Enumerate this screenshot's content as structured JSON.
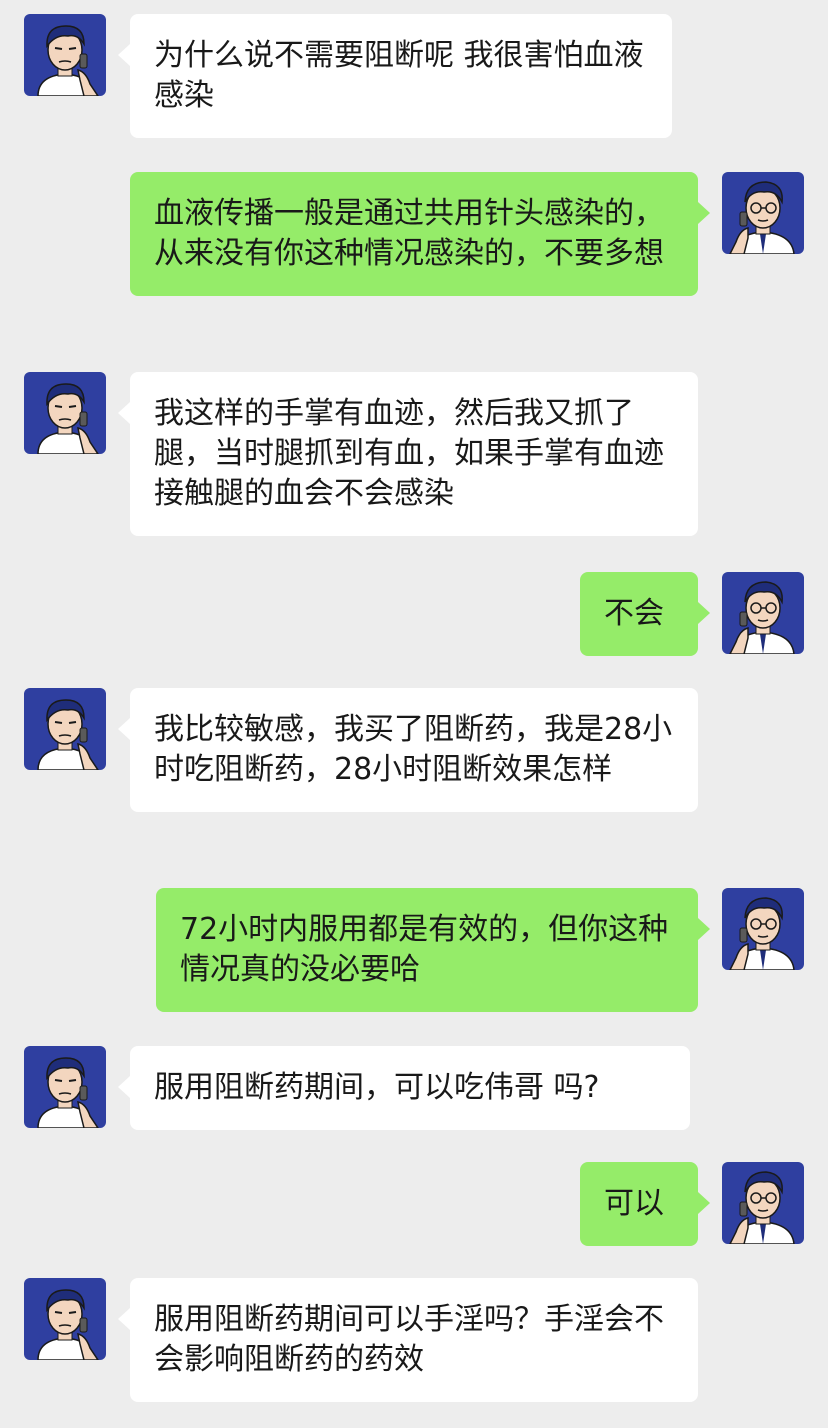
{
  "colors": {
    "background": "#ededed",
    "incoming_bubble": "#ffffff",
    "outgoing_bubble": "#95ec69",
    "avatar_bg": "#2f3fa0"
  },
  "avatars": {
    "patient": "patient-avatar-icon",
    "doctor": "doctor-avatar-icon"
  },
  "messages": [
    {
      "sender": "patient",
      "text": "为什么说不需要阻断呢 我很害怕血液感染"
    },
    {
      "sender": "doctor",
      "text": "血液传播一般是通过共用针头感染的，从来没有你这种情况感染的，不要多想"
    },
    {
      "sender": "patient",
      "text": " 我这样的手掌有血迹，然后我又抓了腿，当时腿抓到有血，如果手掌有血迹接触腿的血会不会感染"
    },
    {
      "sender": "doctor",
      "text": "不会"
    },
    {
      "sender": "patient",
      "text": "我比较敏感，我买了阻断药，我是28小时吃阻断药，28小时阻断效果怎样"
    },
    {
      "sender": "doctor",
      "text": "72小时内服用都是有效的，但你这种情况真的没必要哈"
    },
    {
      "sender": "patient",
      "text": "服用阻断药期间，可以吃伟哥 吗?"
    },
    {
      "sender": "doctor",
      "text": "可以"
    },
    {
      "sender": "patient",
      "text": "服用阻断药期间可以手淫吗？手淫会不会影响阻断药的药效"
    }
  ]
}
